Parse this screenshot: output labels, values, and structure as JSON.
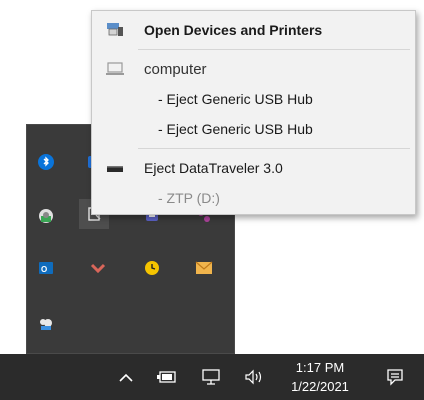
{
  "context_menu": {
    "items": [
      {
        "label": "Open Devices and Printers",
        "icon": "devices-printers-icon",
        "bold": true
      },
      {
        "label": "computer",
        "icon": "computer-icon"
      },
      {
        "label": "- Eject Generic USB Hub"
      },
      {
        "label": "- Eject Generic USB Hub"
      },
      {
        "label": "Eject DataTraveler 3.0",
        "icon": "usb-drive-icon"
      },
      {
        "label": "- ZTP (D:)",
        "disabled": true
      }
    ]
  },
  "tray_flyout": {
    "icons": [
      "bluetooth-icon",
      "app-icon",
      "vpn-shield-icon",
      "usb-safely-remove-icon",
      "teams-icon",
      "slack-icon",
      "outlook-icon",
      "chevron-app-icon",
      "norton-clock-icon",
      "mail-icon",
      "cloud-sync-icon"
    ]
  },
  "taskbar": {
    "icons": [
      "show-hidden-icons-chevron",
      "battery-icon",
      "network-icon",
      "volume-icon",
      "notifications-icon"
    ],
    "clock": {
      "time": "1:17 PM",
      "date": "1/22/2021"
    }
  },
  "colors": {
    "taskbar_bg": "#2b2b2b",
    "flyout_bg": "#3a3a3a",
    "menu_bg": "#f2f2f2",
    "accent_blue": "#0078d7"
  }
}
